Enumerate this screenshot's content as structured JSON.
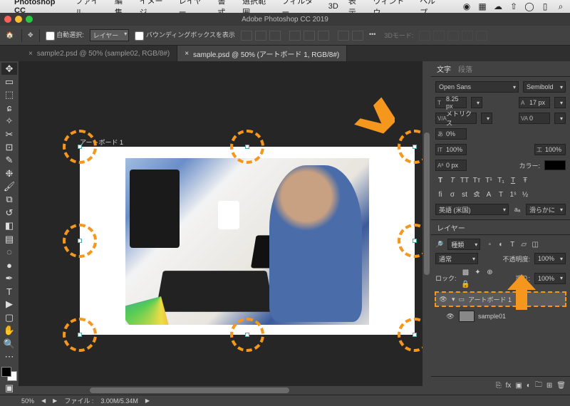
{
  "mac_menu": {
    "app_name": "Photoshop CC",
    "items": [
      "ファイル",
      "編集",
      "イメージ",
      "レイヤー",
      "書式",
      "選択範囲",
      "フィルター",
      "3D",
      "表示",
      "ウィンドウ",
      "ヘルプ"
    ]
  },
  "window_title": "Adobe Photoshop CC 2019",
  "options_bar": {
    "auto_select_checkbox_label": "自動選択:",
    "auto_select_mode": "レイヤー",
    "show_bounding_label": "バウンディングボックスを表示",
    "threed_mode": "3Dモード:"
  },
  "tabs": [
    {
      "title": "sample2.psd @ 50% (sample02, RGB/8#)",
      "active": false,
      "close": "×"
    },
    {
      "title": "sample.psd @ 50% (アートボード 1, RGB/8#)",
      "active": true,
      "close": "×"
    }
  ],
  "artboard_label": "アートボード 1",
  "char_panel": {
    "tab1": "文字",
    "tab2": "段落",
    "font": "Open Sans",
    "weight": "Semibold",
    "size": "8.25 px",
    "leading": "17 px",
    "kerning": "メトリクス",
    "tracking": "0",
    "scale_v": "0%",
    "height_pct": "100%",
    "width_pct": "100%",
    "baseline": "0 px",
    "color_label": "カラー:",
    "lang": "英語 (米国)",
    "aa": "滑らかに"
  },
  "layers_panel": {
    "tab": "レイヤー",
    "kind": "種類",
    "blend": "通常",
    "opacity_label": "不透明度:",
    "opacity": "100%",
    "lock_label": "ロック:",
    "fill_label": "塗り:",
    "fill": "100%",
    "rows": [
      {
        "name": "アートボード 1",
        "expanded": true,
        "selected": true
      },
      {
        "name": "sample01",
        "expanded": false,
        "selected": false
      }
    ]
  },
  "status": {
    "zoom": "50%",
    "file_label": "ファイル :",
    "file_size": "3.00M/5.34M"
  }
}
